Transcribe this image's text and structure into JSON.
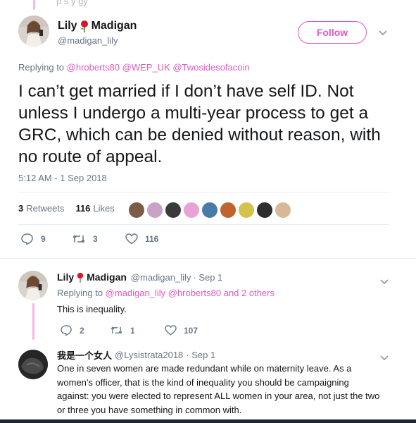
{
  "top_partial_text": "p s  y   gy",
  "main_tweet": {
    "author_name": "Lily",
    "author_name2": "Madigan",
    "handle": "@madigan_lily",
    "follow_label": "Follow",
    "replying_prefix": "Replying to",
    "replying_to": "@hroberts80 @WEP_UK @Twosidesofacoin",
    "text": "I can’t get married if I don’t have self ID. Not unless I undergo a multi-year process to get a GRC, which can be denied without reason, with no route of appeal.",
    "timestamp": "5:12 AM - 1 Sep 2018",
    "retweets_count": "3",
    "retweets_label": "Retweets",
    "likes_count": "116",
    "likes_label": "Likes",
    "actions": {
      "replies": "9",
      "retweets": "3",
      "likes": "116"
    }
  },
  "reply1": {
    "author_name": "Lily",
    "author_name2": "Madigan",
    "handle": "@madigan_lily",
    "date": "· Sep 1",
    "replying_prefix": "Replying to",
    "replying_to": "@madigan_lily @hroberts80",
    "replying_suffix": "and 2 others",
    "text": "This is inequality.",
    "actions": {
      "replies": "2",
      "retweets": "1",
      "likes": "107"
    }
  },
  "reply2": {
    "author_name": "我是一个女人",
    "handle": "@Lysistrata2018",
    "date": "· Sep 1",
    "text_lines": [
      "One in seven women are made redundant while on maternity leave. As a",
      "women's officer, that is the kind of inequality you should be campaigning",
      "against: you were elected to represent ALL women in your area, not just the two",
      "or three you have something in common with."
    ]
  },
  "colors": {
    "accent": "#e05bbf",
    "thread": "#f5b8e8",
    "muted": "#657786"
  },
  "icons": [
    "rose-icon",
    "chevron-down-icon",
    "reply-icon",
    "retweet-icon",
    "heart-icon"
  ]
}
